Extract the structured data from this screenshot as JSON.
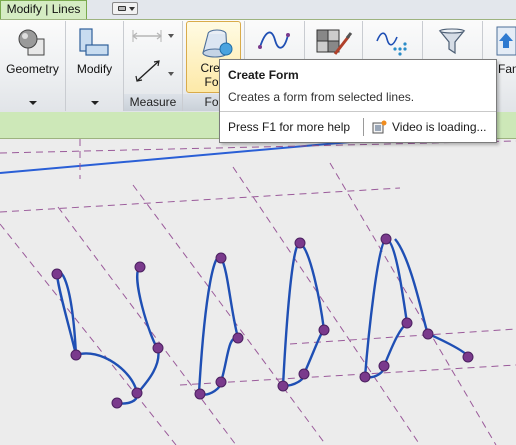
{
  "tabs": {
    "active_label": "Modify | Lines"
  },
  "ribbon": {
    "geometry_label": "Geometry",
    "modify_label": "Modify",
    "measure_panel_title": "Measure",
    "create_form_label_line1": "Crea",
    "create_form_label_line2": "For",
    "form_panel_title": "For",
    "fam_label": "Fam"
  },
  "tooltip": {
    "title": "Create Form",
    "description": "Creates a form from selected lines.",
    "help": "Press F1 for more help",
    "video": "Video is loading..."
  },
  "colors": {
    "curve": "#1f4fb4",
    "vertex": "#7a3a8c",
    "reference_line": "#9a5a9a",
    "tab_active": "#d5ecc3"
  },
  "icons": {
    "tab_extra": "dropdown-icon",
    "geometry": "geometry-icon",
    "modify": "modify-icon",
    "measure": "measure-icon",
    "create_form": "create-form-icon",
    "spline": "spline-icon",
    "paint": "paint-icon",
    "pick": "pick-icon",
    "filter": "filter-icon",
    "fam": "load-family-icon",
    "video": "video-icon"
  }
}
